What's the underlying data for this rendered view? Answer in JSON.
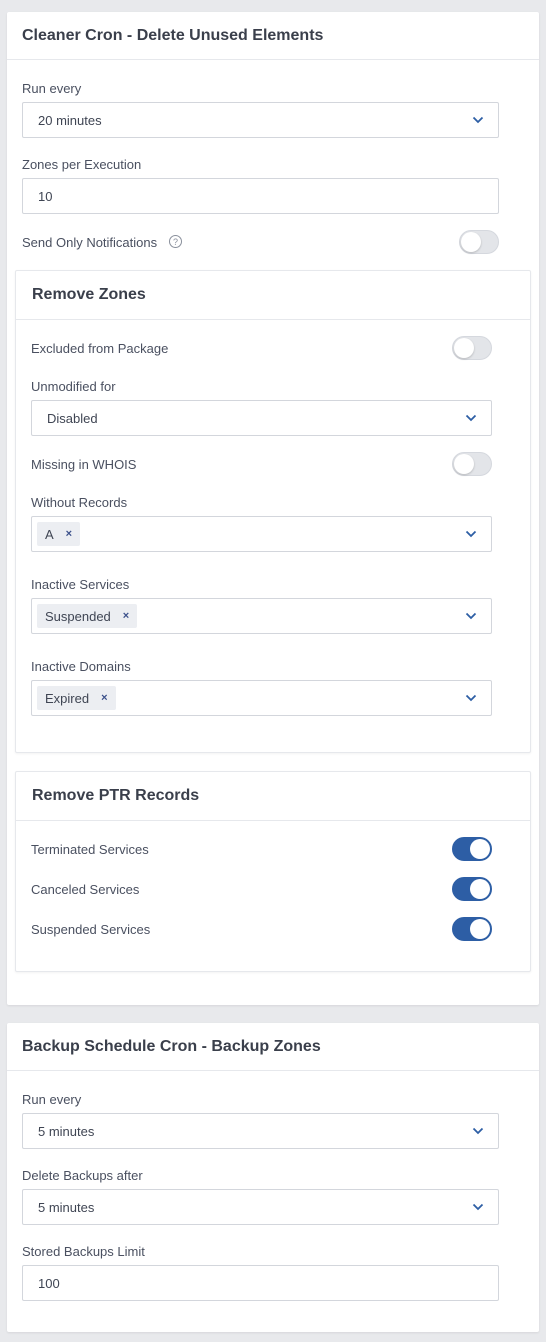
{
  "cleaner": {
    "title": "Cleaner Cron - Delete Unused Elements",
    "run_every_label": "Run every",
    "run_every_value": "20 minutes",
    "zones_label": "Zones per Execution",
    "zones_value": "10",
    "notifications_label": "Send Only Notifications",
    "notifications_on": false,
    "remove_zones": {
      "title": "Remove Zones",
      "excluded_label": "Excluded from Package",
      "excluded_on": false,
      "unmodified_label": "Unmodified for",
      "unmodified_value": "Disabled",
      "whois_label": "Missing in WHOIS",
      "whois_on": false,
      "without_records_label": "Without Records",
      "without_records_tags": [
        "A"
      ],
      "inactive_services_label": "Inactive Services",
      "inactive_services_tags": [
        "Suspended"
      ],
      "inactive_domains_label": "Inactive Domains",
      "inactive_domains_tags": [
        "Expired"
      ],
      "tag_remove": "×"
    },
    "remove_ptr": {
      "title": "Remove PTR Records",
      "terminated_label": "Terminated Services",
      "terminated_on": true,
      "canceled_label": "Canceled Services",
      "canceled_on": true,
      "suspended_label": "Suspended Services",
      "suspended_on": true
    }
  },
  "backup": {
    "title": "Backup Schedule Cron - Backup Zones",
    "run_every_label": "Run every",
    "run_every_value": "5 minutes",
    "delete_label": "Delete Backups after",
    "delete_value": "5 minutes",
    "limit_label": "Stored Backups Limit",
    "limit_value": "100"
  },
  "colors": {
    "accent": "#2d5ea5",
    "tag_x": "#3a4f8a"
  },
  "icons": {
    "help": "question-circle",
    "dropdown": "chevron-down"
  }
}
